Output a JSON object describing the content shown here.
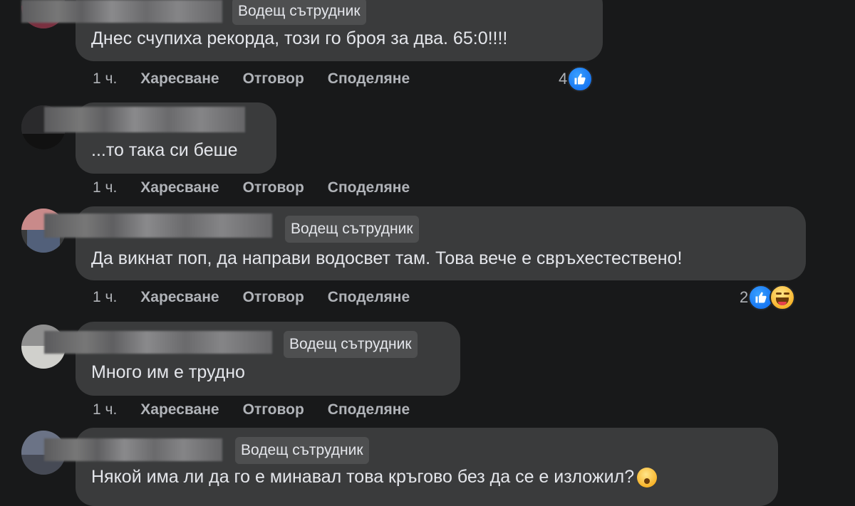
{
  "comments": [
    {
      "badge": "Водещ сътрудник",
      "text": "Днес счупиха рекорда, този го броя за два. 65:0!!!!",
      "time": "1 ч.",
      "reaction_count": "4"
    },
    {
      "text": "...то така си беше",
      "time": "1 ч."
    },
    {
      "badge": "Водещ сътрудник",
      "text": "Да викнат поп, да направи водосвет там. Това вече е свръхестествено!",
      "time": "1 ч.",
      "reaction_count": "2"
    },
    {
      "badge": "Водещ сътрудник",
      "text": "Много им е трудно",
      "time": "1 ч."
    },
    {
      "badge": "Водещ сътрудник",
      "text": "Някой има ли да го е минавал това кръгово без да се е изложил?"
    }
  ],
  "actions": {
    "like": "Харесване",
    "reply": "Отговор",
    "share": "Споделяне"
  },
  "colors": {
    "background": "#18191a",
    "bubble": "#3a3b3c",
    "like_blue": "#1877f2"
  },
  "icons": {
    "like": "thumbs-up-icon",
    "haha": "haha-emoji-icon",
    "emoji": "hushed-face-emoji"
  }
}
